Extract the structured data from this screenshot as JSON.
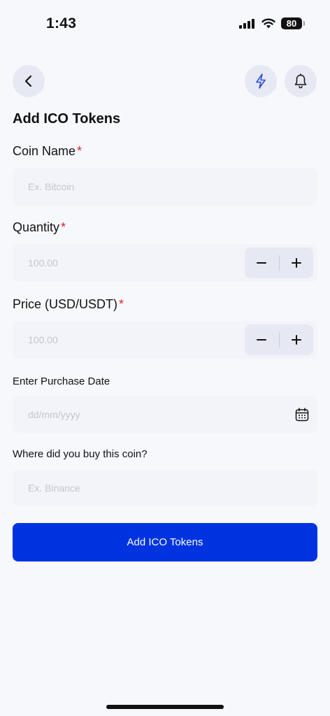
{
  "status_bar": {
    "time": "1:43",
    "battery": "80"
  },
  "header": {
    "title": "Add ICO Tokens"
  },
  "form": {
    "coin_name": {
      "label": "Coin Name",
      "required": "*",
      "placeholder": "Ex. Bitcoin"
    },
    "quantity": {
      "label": "Quantity",
      "required": "*",
      "placeholder": "100.00"
    },
    "price": {
      "label": "Price (USD/USDT)",
      "required": "*",
      "placeholder": "100.00"
    },
    "purchase_date": {
      "label": "Enter Purchase Date",
      "placeholder": "dd/mm/yyyy"
    },
    "exchange": {
      "label": "Where did you buy this coin?",
      "placeholder": "Ex. Binance"
    }
  },
  "submit_label": "Add ICO Tokens",
  "icons": {
    "back": "chevron-left-icon",
    "bolt": "lightning-bolt-icon",
    "bell": "bell-icon",
    "calendar": "calendar-icon",
    "minus": "minus-icon",
    "plus": "plus-icon"
  },
  "colors": {
    "accent": "#0033e0",
    "bolt": "#2a4fd6",
    "required": "#e02424",
    "background": "#f7f8fc",
    "field": "#f3f4f9",
    "placeholder": "#c3c6d0"
  }
}
